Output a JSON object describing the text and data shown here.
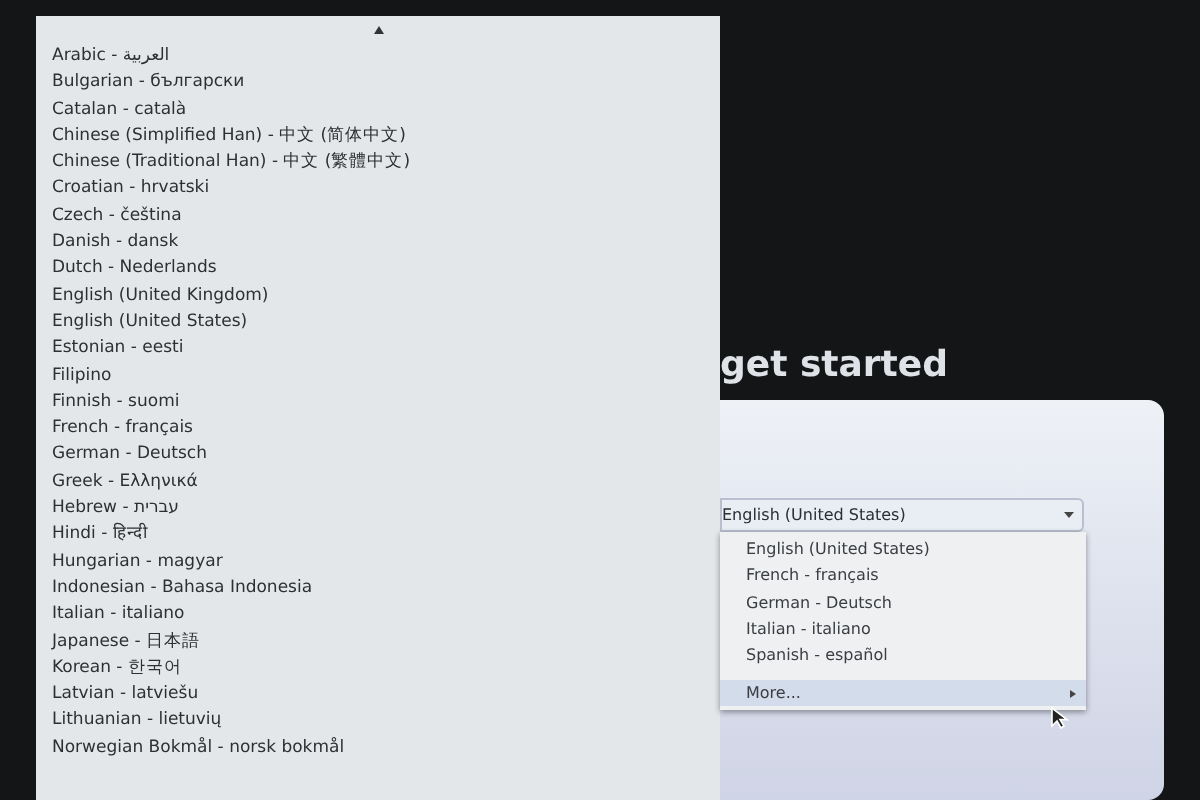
{
  "language_menu": {
    "items": [
      {
        "label": "Arabic - العربية"
      },
      {
        "label": "Bulgarian - български"
      },
      {
        "label": "Catalan - català"
      },
      {
        "label": "Chinese (Simplified Han) - 中文 (简体中文)"
      },
      {
        "label": "Chinese (Traditional Han) - 中文 (繁體中文)"
      },
      {
        "label": "Croatian - hrvatski"
      },
      {
        "label": "Czech - čeština"
      },
      {
        "label": "Danish - dansk"
      },
      {
        "label": "Dutch - Nederlands"
      },
      {
        "label": "English (United Kingdom)"
      },
      {
        "label": "English (United States)"
      },
      {
        "label": "Estonian - eesti"
      },
      {
        "label": "Filipino"
      },
      {
        "label": "Finnish - suomi"
      },
      {
        "label": "French - français"
      },
      {
        "label": "German - Deutsch"
      },
      {
        "label": "Greek - Ελληνικά"
      },
      {
        "label": "Hebrew - עברית"
      },
      {
        "label": "Hindi - हिन्दी"
      },
      {
        "label": "Hungarian - magyar"
      },
      {
        "label": "Indonesian - Bahasa Indonesia"
      },
      {
        "label": "Italian - italiano"
      },
      {
        "label": "Japanese - 日本語"
      },
      {
        "label": "Korean - 한국어"
      },
      {
        "label": "Latvian - latviešu"
      },
      {
        "label": "Lithuanian - lietuvių"
      },
      {
        "label": "Norwegian Bokmål - norsk bokmål"
      }
    ]
  },
  "heading": "get started",
  "language_select": {
    "value": "English (United States)",
    "options": [
      {
        "kind": "option",
        "label": "English (United States)",
        "highlighted": false
      },
      {
        "kind": "option",
        "label": "French - français",
        "highlighted": false
      },
      {
        "kind": "option",
        "label": "German - Deutsch",
        "highlighted": false
      },
      {
        "kind": "option",
        "label": "Italian - italiano",
        "highlighted": false
      },
      {
        "kind": "option",
        "label": "Spanish - español",
        "highlighted": false
      },
      {
        "kind": "submenu",
        "label": "More...",
        "highlighted": true
      }
    ]
  }
}
